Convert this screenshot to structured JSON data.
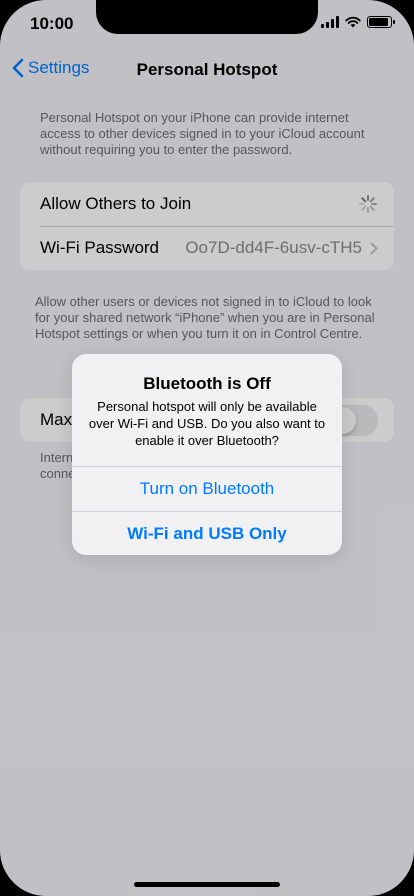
{
  "status": {
    "time": "10:00"
  },
  "nav": {
    "back_label": "Settings",
    "title": "Personal Hotspot"
  },
  "intro": "Personal Hotspot on your iPhone can provide internet access to other devices signed in to your iCloud account without requiring you to enter the password.",
  "rows": {
    "allow_join": "Allow Others to Join",
    "wifi_password_label": "Wi-Fi Password",
    "wifi_password_value": "Oo7D-dd4F-6usv-cTH5"
  },
  "shared_note": "Allow other users or devices not signed in to iCloud to look for your shared network “iPhone” when you are in Personal Hotspot settings or when you turn it on in Control Centre.",
  "max_compat": {
    "label": "Max",
    "enabled": false
  },
  "compat_note": [
    "Intern",
    "conne"
  ],
  "alert": {
    "title": "Bluetooth is Off",
    "message": "Personal hotspot will only be available over Wi-Fi and USB. Do you also want to enable it over Bluetooth?",
    "button_bluetooth": "Turn on Bluetooth",
    "button_wifi_usb": "Wi-Fi and USB Only"
  },
  "icons": [
    "signal-icon",
    "wifi-icon",
    "battery-icon",
    "chevron-left-icon",
    "chevron-right-icon",
    "spinner-icon"
  ],
  "colors": {
    "accent": "#007aff",
    "background": "#f2f2f7",
    "secondary_text": "#6d6d72"
  }
}
